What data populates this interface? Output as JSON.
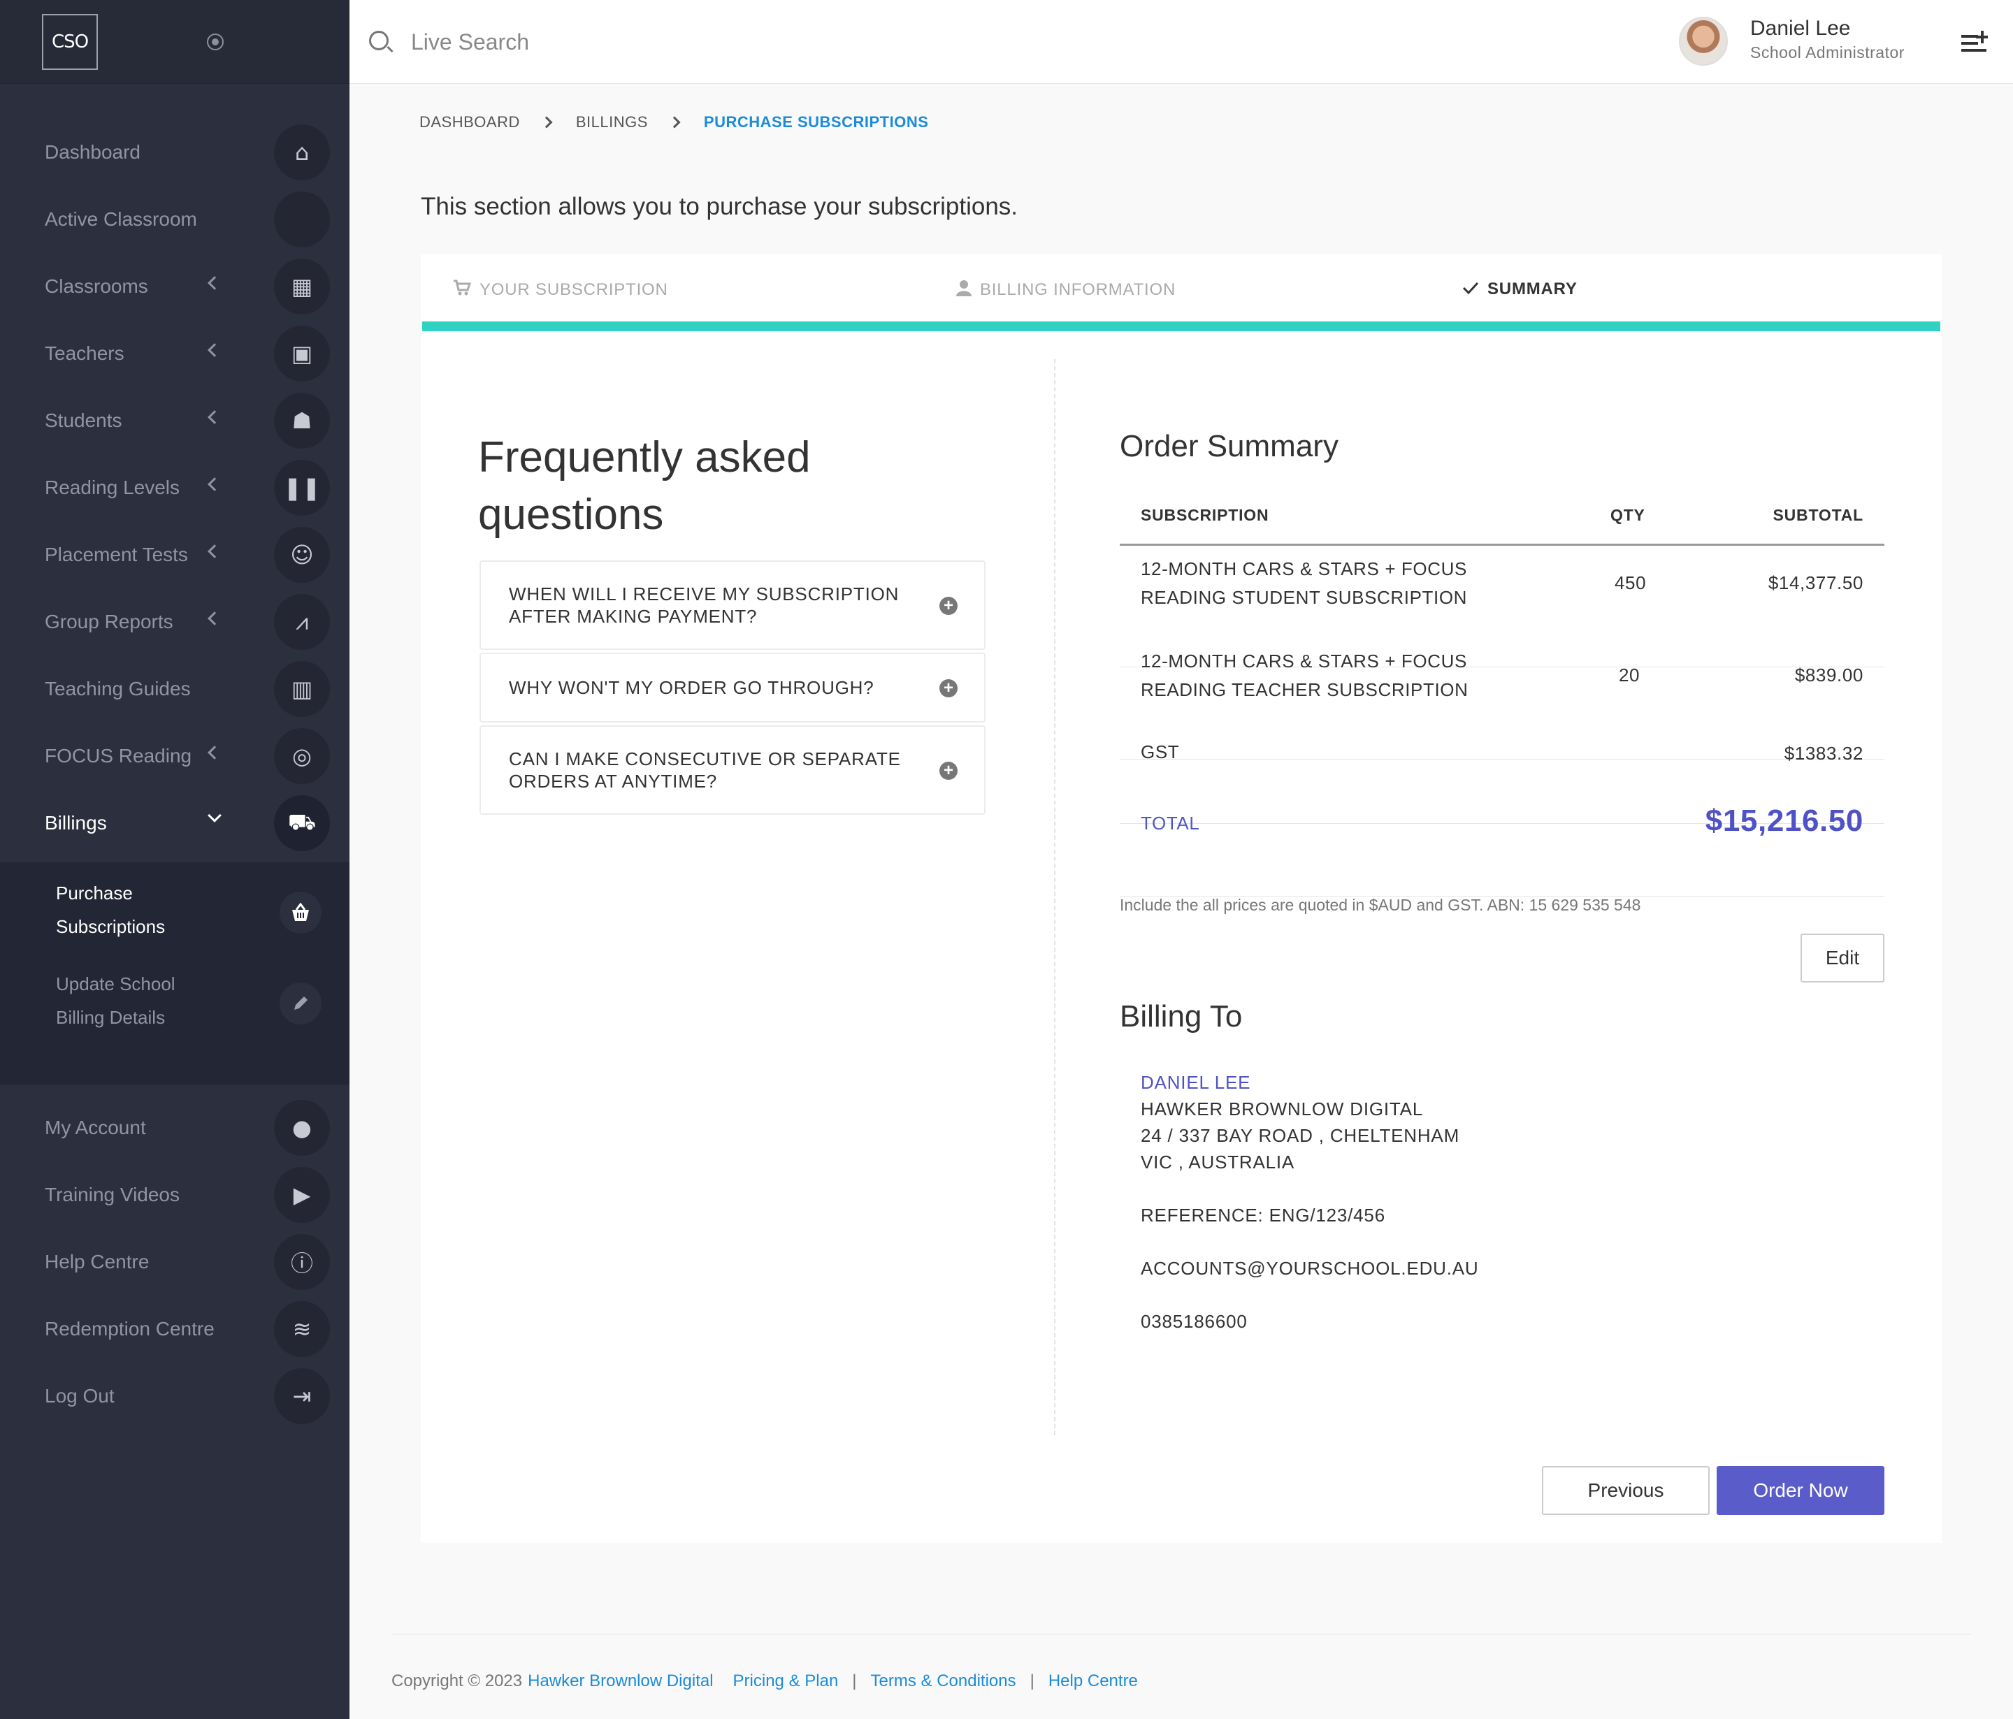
{
  "sidebar": {
    "logo": "CSO",
    "items": [
      {
        "label": "Dashboard",
        "icon": "home-icon",
        "glyph": "⌂",
        "chev": false
      },
      {
        "label": "Active Classroom",
        "icon": "blank-icon",
        "glyph": "",
        "chev": false
      },
      {
        "label": "Classrooms",
        "icon": "classroom-icon",
        "glyph": "▦",
        "chev": true
      },
      {
        "label": "Teachers",
        "icon": "teacher-icon",
        "glyph": "▣",
        "chev": true
      },
      {
        "label": "Students",
        "icon": "student-icon",
        "glyph": "☗",
        "chev": true
      },
      {
        "label": "Reading Levels",
        "icon": "book-icon",
        "glyph": "❚❚",
        "chev": true
      },
      {
        "label": "Placement Tests",
        "icon": "smile-icon",
        "glyph": "☺",
        "chev": true
      },
      {
        "label": "Group Reports",
        "icon": "chart-icon",
        "glyph": "⩘",
        "chev": true
      },
      {
        "label": "Teaching Guides",
        "icon": "library-icon",
        "glyph": "▥",
        "chev": false
      },
      {
        "label": "FOCUS Reading",
        "icon": "target-icon",
        "glyph": "◎",
        "chev": true
      },
      {
        "label": "Billings",
        "icon": "cart-icon",
        "glyph": "⛟",
        "chev": true
      }
    ],
    "submenu": [
      {
        "label_line1": "Purchase",
        "label_line2": "Subscriptions",
        "icon": "basket-icon",
        "glyph": "⌺"
      },
      {
        "label_line1": "Update School",
        "label_line2": "Billing Details",
        "icon": "pencil-icon",
        "glyph": "✎"
      }
    ],
    "items2": [
      {
        "label": "My Account",
        "icon": "user-icon",
        "glyph": "●"
      },
      {
        "label": "Training Videos",
        "icon": "video-icon",
        "glyph": "▶"
      },
      {
        "label": "Help Centre",
        "icon": "info-icon",
        "glyph": "ⓘ"
      },
      {
        "label": "Redemption Centre",
        "icon": "handshake-icon",
        "glyph": "≋"
      },
      {
        "label": "Log Out",
        "icon": "logout-icon",
        "glyph": "⇥"
      }
    ]
  },
  "header": {
    "search_placeholder": "Live Search",
    "user_name": "Daniel Lee",
    "user_role": "School Administrator"
  },
  "breadcrumb": [
    "DASHBOARD",
    "BILLINGS",
    "PURCHASE SUBSCRIPTIONS"
  ],
  "intro": "This section allows you to purchase your subscriptions.",
  "steps": [
    {
      "label": "YOUR SUBSCRIPTION",
      "icon": "cart-icon"
    },
    {
      "label": "BILLING INFORMATION",
      "icon": "user-icon"
    },
    {
      "label": "SUMMARY",
      "icon": "check-icon"
    }
  ],
  "progress_fraction": 1.0,
  "colors": {
    "accent": "#5a5cc9",
    "progress": "#2fd2c1",
    "link": "#1a8cd8",
    "sidebar": "#2c303e"
  },
  "faq": {
    "title_line1": "Frequently asked",
    "title_line2": "questions",
    "items": [
      {
        "line1": "WHEN WILL I RECEIVE MY SUBSCRIPTION",
        "line2": "AFTER MAKING PAYMENT?"
      },
      {
        "line1": "WHY WON'T MY ORDER GO THROUGH?",
        "line2": ""
      },
      {
        "line1": "CAN I MAKE CONSECUTIVE OR SEPARATE",
        "line2": "ORDERS AT ANYTIME?"
      }
    ]
  },
  "order": {
    "title": "Order Summary",
    "headers": {
      "subscription": "SUBSCRIPTION",
      "qty": "QTY",
      "subtotal": "SUBTOTAL"
    },
    "rows": [
      {
        "line1": "12-MONTH CARS & STARS + FOCUS",
        "line2": "READING STUDENT SUBSCRIPTION",
        "qty": "450",
        "subtotal": "$14,377.50"
      },
      {
        "line1": "12-MONTH CARS & STARS + FOCUS",
        "line2": "READING TEACHER SUBSCRIPTION",
        "qty": "20",
        "subtotal": "$839.00"
      }
    ],
    "gst_label": "GST",
    "gst_value": "$1383.32",
    "total_label": "TOTAL",
    "total_value": "$15,216.50",
    "note": "Include the all prices are quoted in $AUD and GST. ABN: 15 629 535 548",
    "edit_label": "Edit"
  },
  "billing": {
    "title": "Billing To",
    "name": "DANIEL  LEE",
    "company": "HAWKER BROWNLOW DIGITAL",
    "address1": "24 / 337 BAY ROAD ,  CHELTENHAM",
    "address2": "VIC ,  AUSTRALIA",
    "reference": "REFERENCE: ENG/123/456",
    "email": "ACCOUNTS@YOURSCHOOL.EDU.AU",
    "phone": "0385186600"
  },
  "buttons": {
    "previous": "Previous",
    "order_now": "Order Now"
  },
  "footer": {
    "copyright": "Copyright © 2023",
    "company": "Hawker Brownlow Digital",
    "links": [
      "Pricing & Plan",
      "Terms & Conditions",
      "Help Centre"
    ]
  }
}
